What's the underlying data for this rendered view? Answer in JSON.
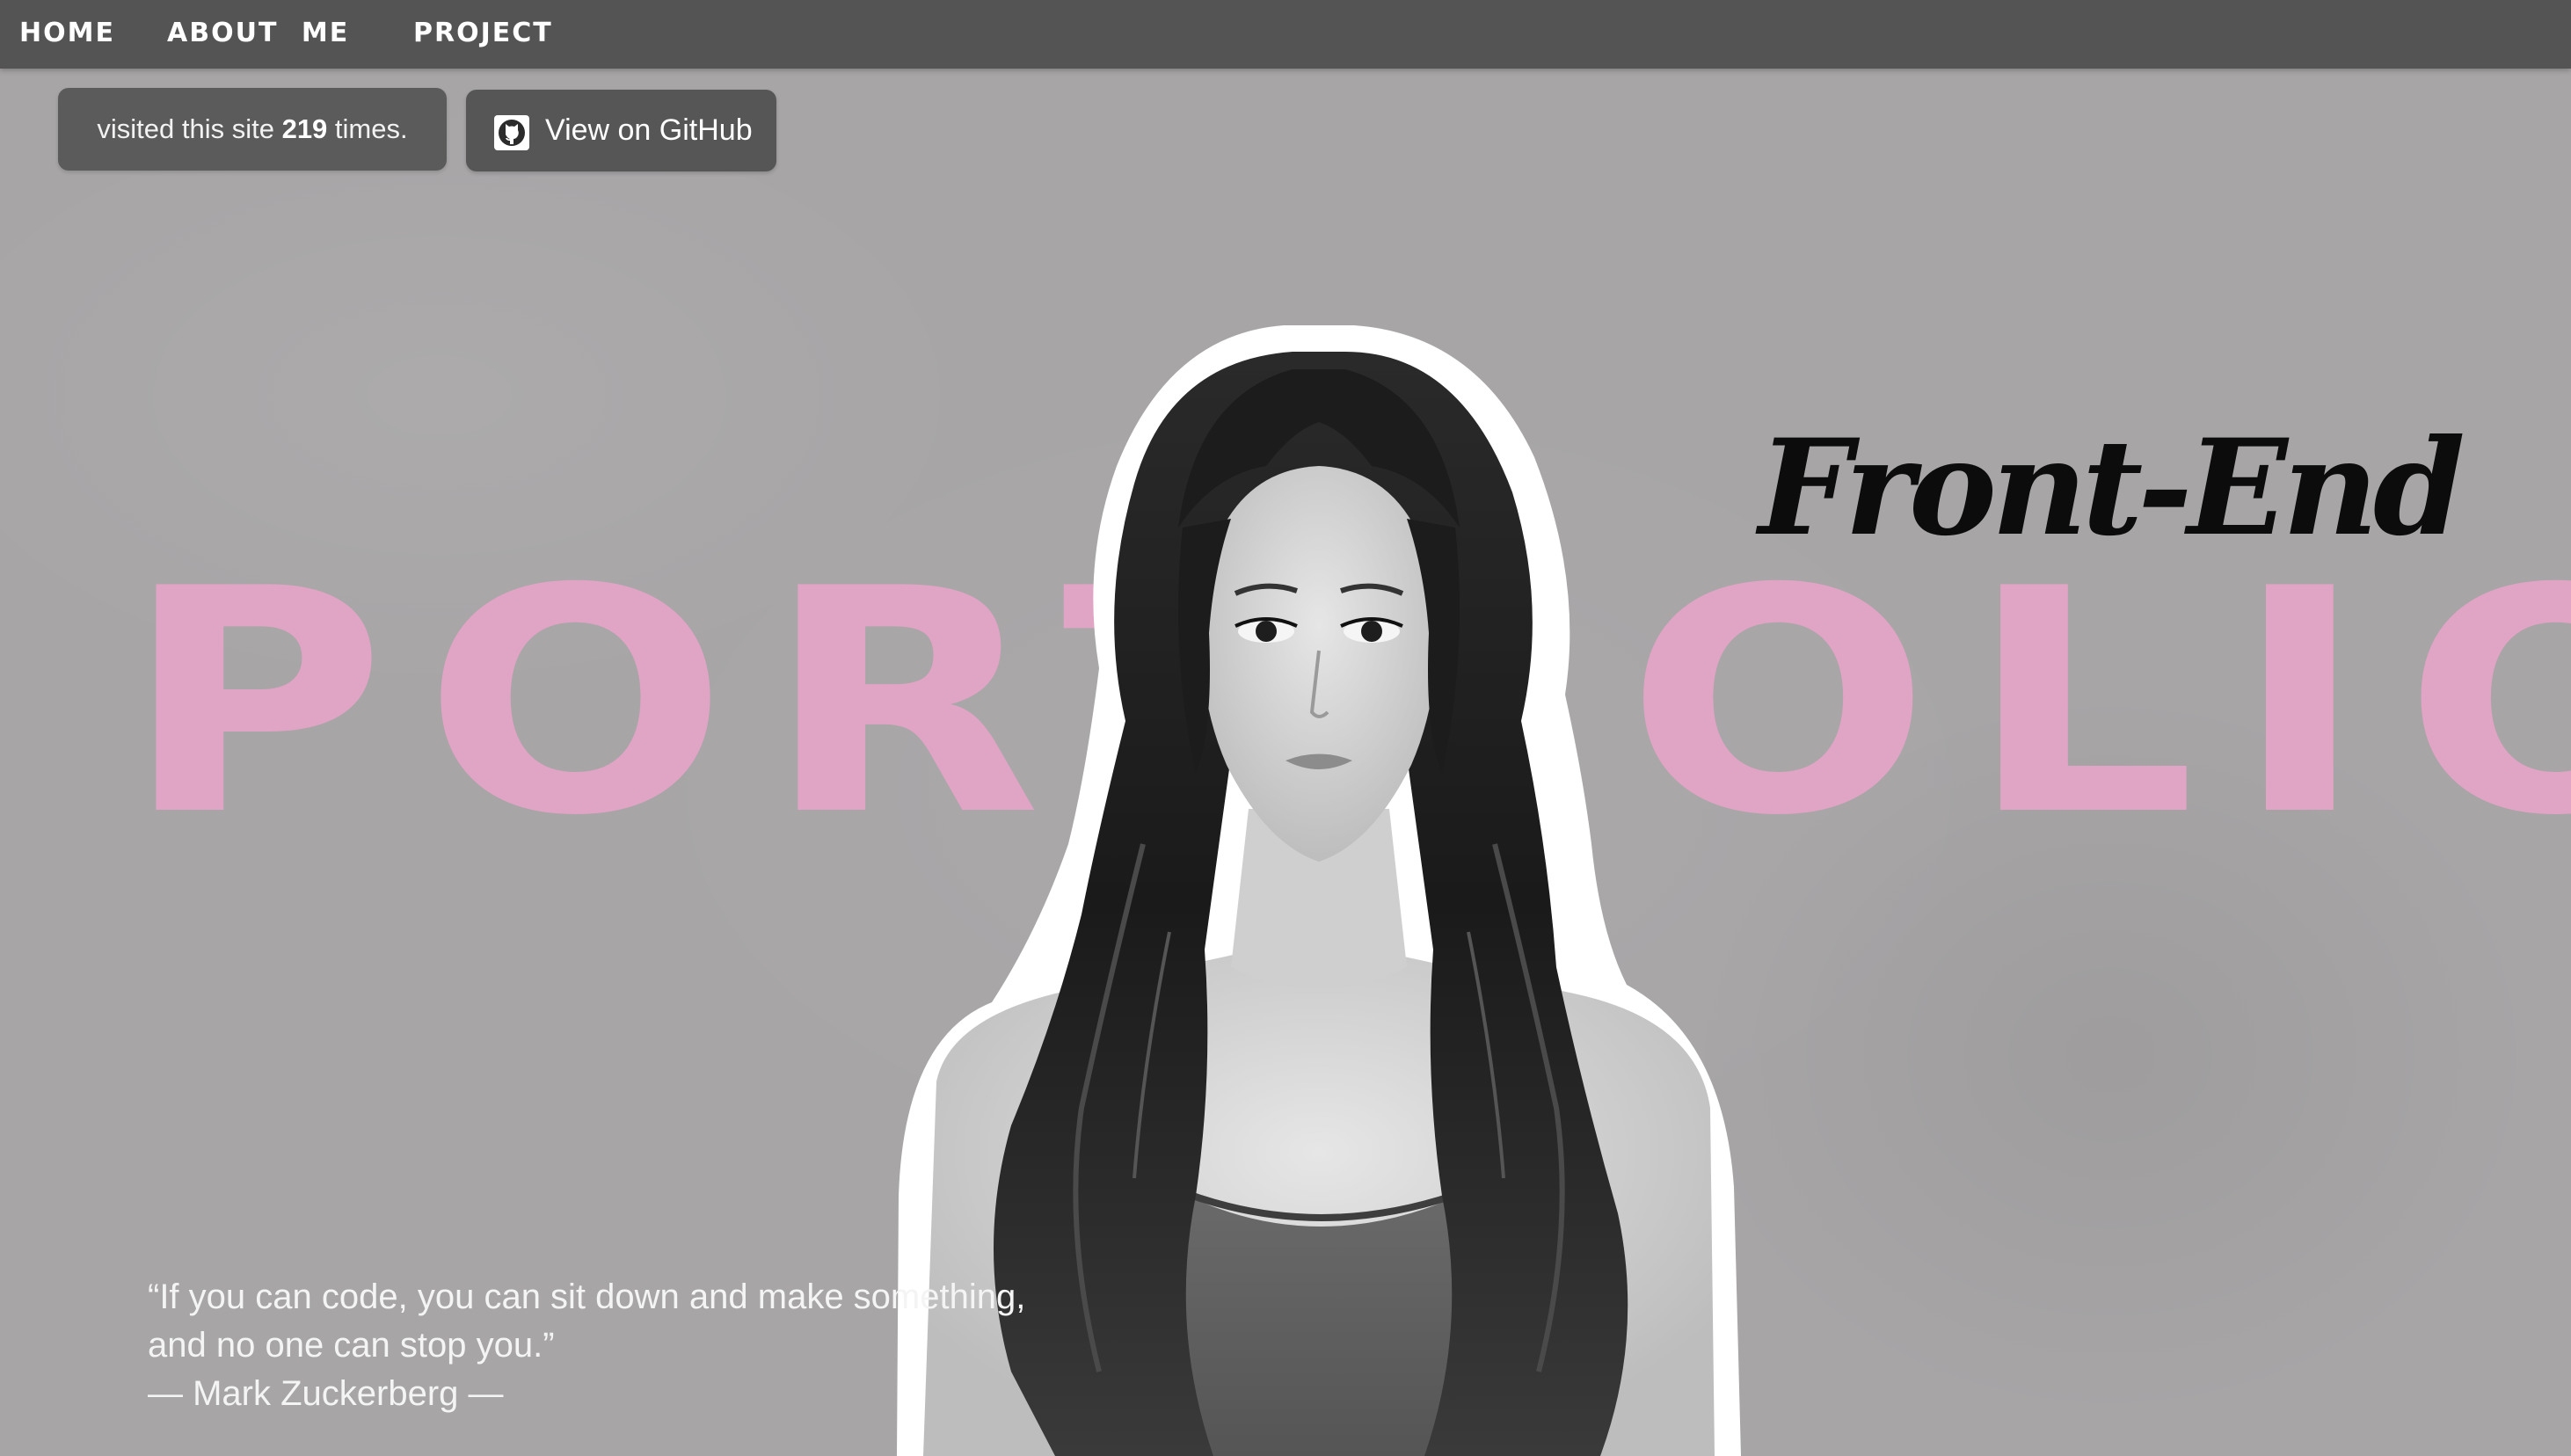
{
  "nav": {
    "items": [
      {
        "label": "HOME"
      },
      {
        "label": "ABOUT ME"
      },
      {
        "label": "PROJECT"
      }
    ]
  },
  "visit_counter": {
    "prefix": "visited this site ",
    "count": "219",
    "suffix": " times."
  },
  "github_button": {
    "label": "View on GitHub",
    "icon": "github-icon"
  },
  "hero": {
    "big_word": "PORTFOLIO",
    "subtitle": "Front-End",
    "big_word_color": "#e0a4c4"
  },
  "quote": {
    "line1": "“If you can code, you can sit down and make something,",
    "line2": "and no one can stop you.”",
    "author": "— Mark Zuckerberg —"
  },
  "colors": {
    "background": "#a7a5a6",
    "navbar": "#555455",
    "badge": "#5c5b5c",
    "accent_pink": "#e0a4c4"
  }
}
